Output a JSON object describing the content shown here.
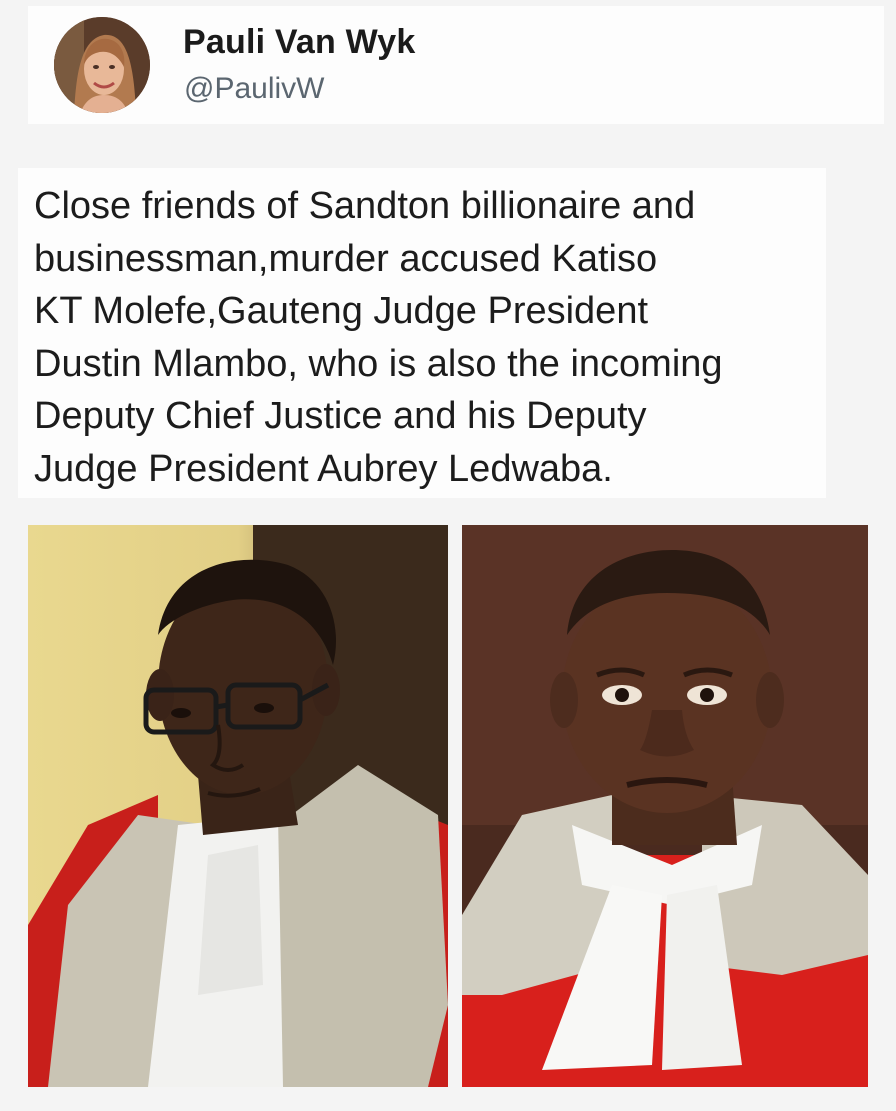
{
  "post": {
    "author": {
      "display_name": "Pauli Van Wyk",
      "handle": "@PaulivW",
      "avatar_icon": "profile-photo"
    },
    "text": "Close friends of Sandton billionaire and\nbusinessman,murder accused Katiso\nKT Molefe,Gauteng Judge President\nDustin Mlambo, who is also the incoming\nDeputy Chief Justice and his Deputy\nJudge President Aubrey Ledwaba.",
    "images": [
      {
        "depicts": "portrait-left",
        "description_icon": "judge-in-robes-glasses"
      },
      {
        "depicts": "portrait-right",
        "description_icon": "judge-in-robes"
      }
    ]
  },
  "colors": {
    "page_background": "#f4f4f4",
    "card_background": "#fdfdfd",
    "text_primary": "#1c1c1c",
    "text_secondary": "#5b6670",
    "robe_red": "#d8201c",
    "robe_grey": "#c9c4b4"
  }
}
